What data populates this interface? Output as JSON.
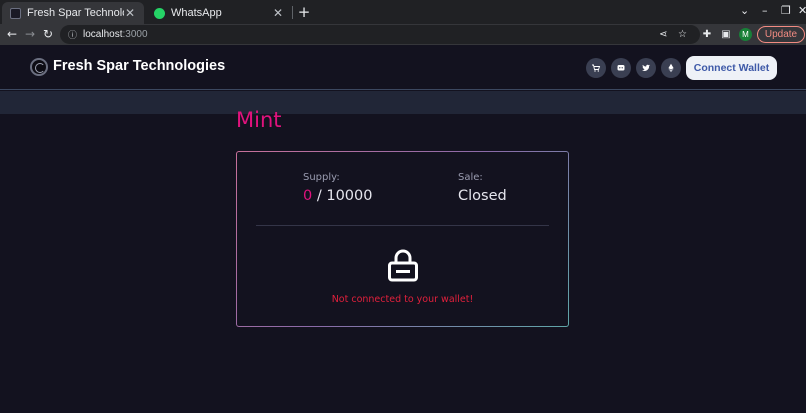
{
  "browser": {
    "tabs": [
      {
        "title": "Fresh Spar Technologies",
        "active": true
      },
      {
        "title": "WhatsApp",
        "active": false
      }
    ],
    "url_host": "localhost",
    "url_port": ":3000",
    "profile_initial": "M",
    "update_label": "Update"
  },
  "site": {
    "brand_name": "Fresh Spar Technologies",
    "social_icons": [
      "cart-icon",
      "discord-icon",
      "twitter-icon",
      "ethereum-icon"
    ],
    "connect_label": "Connect Wallet"
  },
  "mint": {
    "title": "Mint",
    "supply_label": "Supply:",
    "minted": "0",
    "supply_separator": " / ",
    "max_supply": "10000",
    "sale_label": "Sale:",
    "sale_status": "Closed",
    "status_message": "Not connected to your wallet!"
  },
  "colors": {
    "accent": "#e0127d",
    "error": "#e0203c",
    "background": "#13121f",
    "button_text": "#3e59a8"
  }
}
